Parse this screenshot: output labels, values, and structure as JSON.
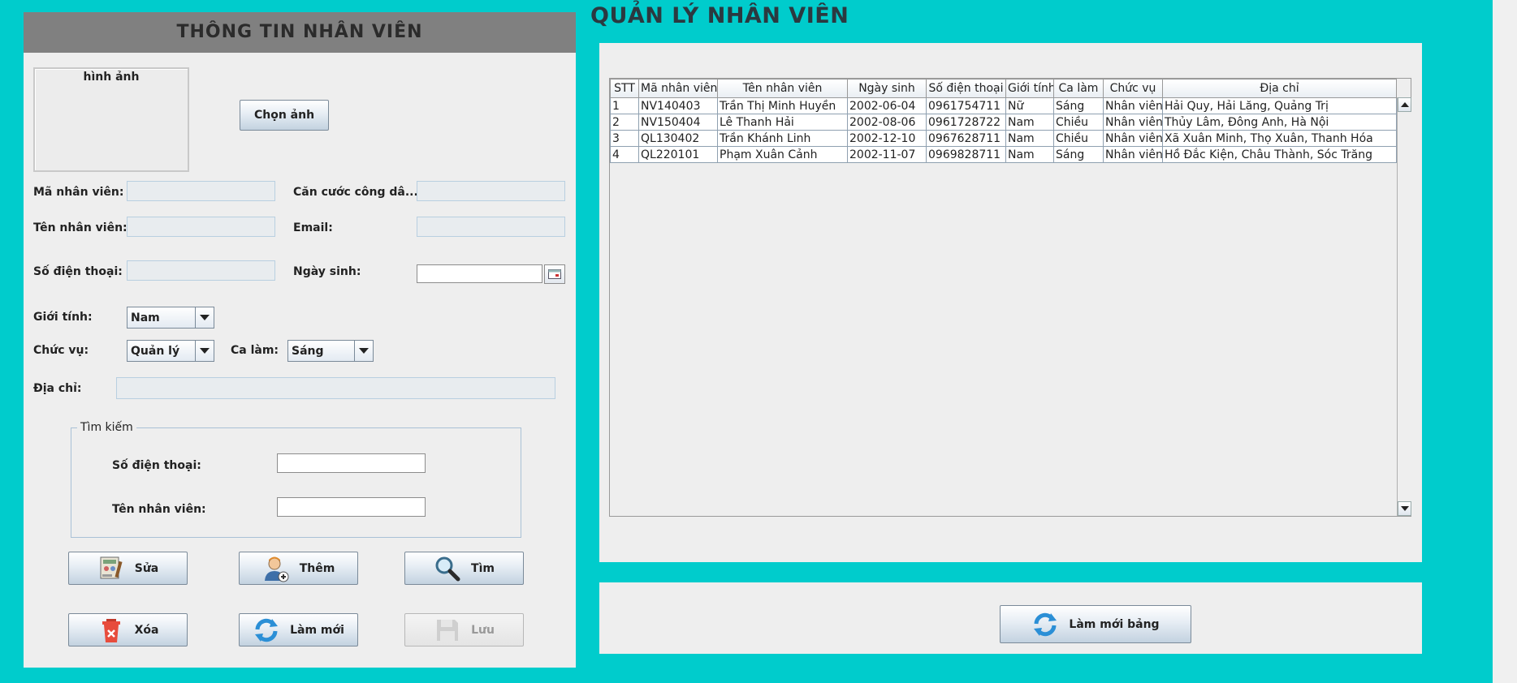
{
  "app": {
    "title": "QUẢN LÝ NHÂN VIÊN"
  },
  "form": {
    "header": "THÔNG TIN NHÂN VIÊN",
    "image_label": "hình ảnh",
    "choose_image_label": "Chọn ảnh",
    "fields": {
      "employee_id": {
        "label": "Mã nhân viên:",
        "value": ""
      },
      "citizen_id": {
        "label": "Căn cước công dâ...",
        "value": ""
      },
      "employee_name": {
        "label": "Tên nhân viên:",
        "value": ""
      },
      "email": {
        "label": "Email:",
        "value": ""
      },
      "phone": {
        "label": "Số điện thoại:",
        "value": ""
      },
      "birthday": {
        "label": "Ngày sinh:",
        "value": ""
      },
      "gender": {
        "label": "Giới tính:",
        "value": "Nam"
      },
      "position": {
        "label": "Chức vụ:",
        "value": "Quản lý"
      },
      "shift": {
        "label": "Ca làm:",
        "value": "Sáng"
      },
      "address": {
        "label": "Địa chỉ:",
        "value": ""
      }
    },
    "search": {
      "legend": "Tìm kiếm",
      "phone_label": "Số điện thoại:",
      "phone_value": "",
      "name_label": "Tên nhân viên:",
      "name_value": ""
    },
    "buttons": {
      "edit": "Sửa",
      "add": "Thêm",
      "find": "Tìm",
      "delete": "Xóa",
      "refresh": "Làm mới",
      "save": "Lưu"
    }
  },
  "table": {
    "columns": [
      "STT",
      "Mã nhân viên",
      "Tên nhân viên",
      "Ngày sinh",
      "Số điện thoại",
      "Giới tính",
      "Ca làm",
      "Chức vụ",
      "Địa chỉ"
    ],
    "rows": [
      [
        "1",
        "NV140403",
        "Trần Thị Minh Huyền",
        "2002-06-04",
        "0961754711",
        "Nữ",
        "Sáng",
        "Nhân viên",
        "Hải Quy, Hải Lăng,  Quảng Trị"
      ],
      [
        "2",
        "NV150404",
        "Lê Thanh Hải",
        "2002-08-06",
        "0961728722",
        "Nam",
        "Chiều",
        "Nhân viên",
        "Thủy Lâm, Đông Anh, Hà Nội"
      ],
      [
        "3",
        "QL130402",
        "Trần Khánh Linh",
        "2002-12-10",
        "0967628711",
        "Nam",
        "Chiều",
        "Nhân viên",
        "Xã Xuân Minh, Thọ Xuân, Thanh Hóa"
      ],
      [
        "4",
        "QL220101",
        "Phạm Xuân Cảnh",
        "2002-11-07",
        "0969828711",
        "Nam",
        "Sáng",
        "Nhân viên",
        "Hồ Đắc Kiện, Châu Thành, Sóc Trăng"
      ]
    ],
    "refresh_table_label": "Làm mới bảng"
  },
  "colors": {
    "background": "#00cccc",
    "panel": "#eeeeee",
    "header_bar": "#808080"
  }
}
